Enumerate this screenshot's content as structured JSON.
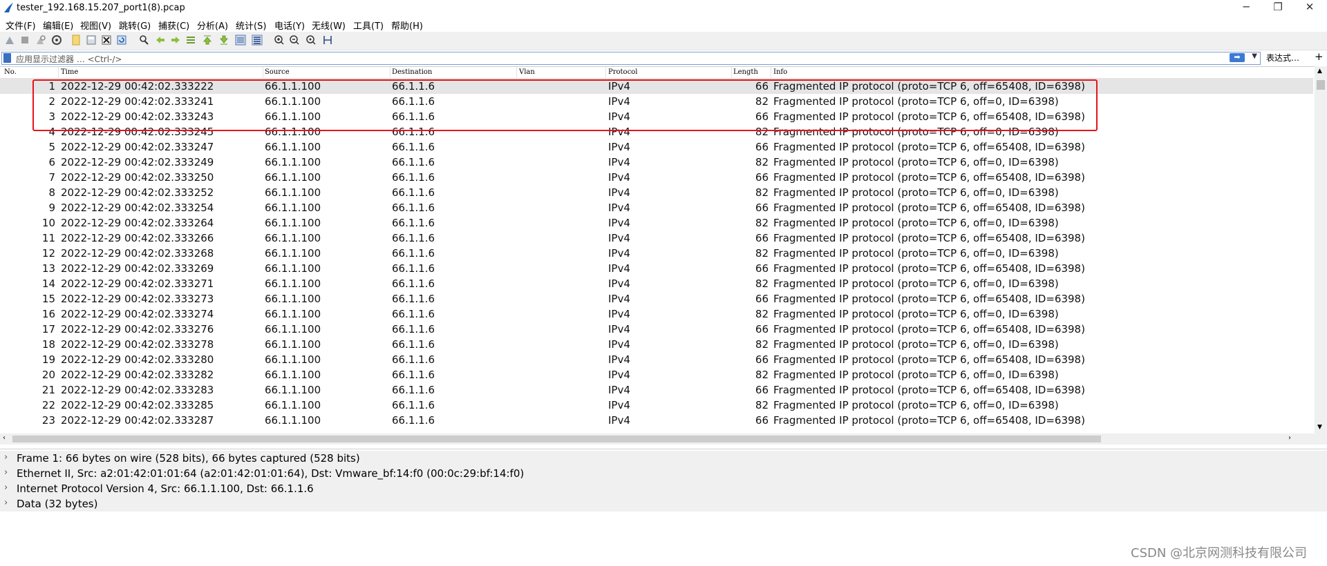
{
  "window": {
    "title": "tester_192.168.15.207_port1(8).pcap",
    "controls": {
      "minimize": "─",
      "restore": "❐",
      "close": "✕"
    }
  },
  "menu": [
    "文件(F)",
    "编辑(E)",
    "视图(V)",
    "跳转(G)",
    "捕获(C)",
    "分析(A)",
    "统计(S)",
    "电话(Y)",
    "无线(W)",
    "工具(T)",
    "帮助(H)"
  ],
  "toolbar_icons": [
    "start-capture-icon",
    "stop-capture-icon",
    "restart-capture-icon",
    "capture-options-icon",
    "open-file-icon",
    "save-file-icon",
    "close-file-icon",
    "reload-icon",
    "find-packet-icon",
    "go-back-icon",
    "go-forward-icon",
    "go-to-packet-icon",
    "go-first-icon",
    "go-last-icon",
    "autoscroll-icon",
    "colorize-icon",
    "zoom-in-icon",
    "zoom-out-icon",
    "zoom-normal-icon",
    "resize-columns-icon"
  ],
  "filter": {
    "placeholder": "应用显示过滤器 … <Ctrl-/>",
    "apply_label": "➡",
    "expression_label": "表达式…",
    "add_label": "+"
  },
  "columns": {
    "no": "No.",
    "time": "Time",
    "source": "Source",
    "destination": "Destination",
    "vlan": "Vlan",
    "protocol": "Protocol",
    "length": "Length",
    "info": "Info"
  },
  "packets": [
    {
      "no": "1",
      "time": "2022-12-29 00:42:02.333222",
      "src": "66.1.1.100",
      "dst": "66.1.1.6",
      "vlan": "",
      "proto": "IPv4",
      "len": "66",
      "info": "Fragmented IP protocol (proto=TCP 6, off=65408, ID=6398)"
    },
    {
      "no": "2",
      "time": "2022-12-29 00:42:02.333241",
      "src": "66.1.1.100",
      "dst": "66.1.1.6",
      "vlan": "",
      "proto": "IPv4",
      "len": "82",
      "info": "Fragmented IP protocol (proto=TCP 6, off=0, ID=6398)"
    },
    {
      "no": "3",
      "time": "2022-12-29 00:42:02.333243",
      "src": "66.1.1.100",
      "dst": "66.1.1.6",
      "vlan": "",
      "proto": "IPv4",
      "len": "66",
      "info": "Fragmented IP protocol (proto=TCP 6, off=65408, ID=6398)"
    },
    {
      "no": "4",
      "time": "2022-12-29 00:42:02.333245",
      "src": "66.1.1.100",
      "dst": "66.1.1.6",
      "vlan": "",
      "proto": "IPv4",
      "len": "82",
      "info": "Fragmented IP protocol (proto=TCP 6, off=0, ID=6398)"
    },
    {
      "no": "5",
      "time": "2022-12-29 00:42:02.333247",
      "src": "66.1.1.100",
      "dst": "66.1.1.6",
      "vlan": "",
      "proto": "IPv4",
      "len": "66",
      "info": "Fragmented IP protocol (proto=TCP 6, off=65408, ID=6398)"
    },
    {
      "no": "6",
      "time": "2022-12-29 00:42:02.333249",
      "src": "66.1.1.100",
      "dst": "66.1.1.6",
      "vlan": "",
      "proto": "IPv4",
      "len": "82",
      "info": "Fragmented IP protocol (proto=TCP 6, off=0, ID=6398)"
    },
    {
      "no": "7",
      "time": "2022-12-29 00:42:02.333250",
      "src": "66.1.1.100",
      "dst": "66.1.1.6",
      "vlan": "",
      "proto": "IPv4",
      "len": "66",
      "info": "Fragmented IP protocol (proto=TCP 6, off=65408, ID=6398)"
    },
    {
      "no": "8",
      "time": "2022-12-29 00:42:02.333252",
      "src": "66.1.1.100",
      "dst": "66.1.1.6",
      "vlan": "",
      "proto": "IPv4",
      "len": "82",
      "info": "Fragmented IP protocol (proto=TCP 6, off=0, ID=6398)"
    },
    {
      "no": "9",
      "time": "2022-12-29 00:42:02.333254",
      "src": "66.1.1.100",
      "dst": "66.1.1.6",
      "vlan": "",
      "proto": "IPv4",
      "len": "66",
      "info": "Fragmented IP protocol (proto=TCP 6, off=65408, ID=6398)"
    },
    {
      "no": "10",
      "time": "2022-12-29 00:42:02.333264",
      "src": "66.1.1.100",
      "dst": "66.1.1.6",
      "vlan": "",
      "proto": "IPv4",
      "len": "82",
      "info": "Fragmented IP protocol (proto=TCP 6, off=0, ID=6398)"
    },
    {
      "no": "11",
      "time": "2022-12-29 00:42:02.333266",
      "src": "66.1.1.100",
      "dst": "66.1.1.6",
      "vlan": "",
      "proto": "IPv4",
      "len": "66",
      "info": "Fragmented IP protocol (proto=TCP 6, off=65408, ID=6398)"
    },
    {
      "no": "12",
      "time": "2022-12-29 00:42:02.333268",
      "src": "66.1.1.100",
      "dst": "66.1.1.6",
      "vlan": "",
      "proto": "IPv4",
      "len": "82",
      "info": "Fragmented IP protocol (proto=TCP 6, off=0, ID=6398)"
    },
    {
      "no": "13",
      "time": "2022-12-29 00:42:02.333269",
      "src": "66.1.1.100",
      "dst": "66.1.1.6",
      "vlan": "",
      "proto": "IPv4",
      "len": "66",
      "info": "Fragmented IP protocol (proto=TCP 6, off=65408, ID=6398)"
    },
    {
      "no": "14",
      "time": "2022-12-29 00:42:02.333271",
      "src": "66.1.1.100",
      "dst": "66.1.1.6",
      "vlan": "",
      "proto": "IPv4",
      "len": "82",
      "info": "Fragmented IP protocol (proto=TCP 6, off=0, ID=6398)"
    },
    {
      "no": "15",
      "time": "2022-12-29 00:42:02.333273",
      "src": "66.1.1.100",
      "dst": "66.1.1.6",
      "vlan": "",
      "proto": "IPv4",
      "len": "66",
      "info": "Fragmented IP protocol (proto=TCP 6, off=65408, ID=6398)"
    },
    {
      "no": "16",
      "time": "2022-12-29 00:42:02.333274",
      "src": "66.1.1.100",
      "dst": "66.1.1.6",
      "vlan": "",
      "proto": "IPv4",
      "len": "82",
      "info": "Fragmented IP protocol (proto=TCP 6, off=0, ID=6398)"
    },
    {
      "no": "17",
      "time": "2022-12-29 00:42:02.333276",
      "src": "66.1.1.100",
      "dst": "66.1.1.6",
      "vlan": "",
      "proto": "IPv4",
      "len": "66",
      "info": "Fragmented IP protocol (proto=TCP 6, off=65408, ID=6398)"
    },
    {
      "no": "18",
      "time": "2022-12-29 00:42:02.333278",
      "src": "66.1.1.100",
      "dst": "66.1.1.6",
      "vlan": "",
      "proto": "IPv4",
      "len": "82",
      "info": "Fragmented IP protocol (proto=TCP 6, off=0, ID=6398)"
    },
    {
      "no": "19",
      "time": "2022-12-29 00:42:02.333280",
      "src": "66.1.1.100",
      "dst": "66.1.1.6",
      "vlan": "",
      "proto": "IPv4",
      "len": "66",
      "info": "Fragmented IP protocol (proto=TCP 6, off=65408, ID=6398)"
    },
    {
      "no": "20",
      "time": "2022-12-29 00:42:02.333282",
      "src": "66.1.1.100",
      "dst": "66.1.1.6",
      "vlan": "",
      "proto": "IPv4",
      "len": "82",
      "info": "Fragmented IP protocol (proto=TCP 6, off=0, ID=6398)"
    },
    {
      "no": "21",
      "time": "2022-12-29 00:42:02.333283",
      "src": "66.1.1.100",
      "dst": "66.1.1.6",
      "vlan": "",
      "proto": "IPv4",
      "len": "66",
      "info": "Fragmented IP protocol (proto=TCP 6, off=65408, ID=6398)"
    },
    {
      "no": "22",
      "time": "2022-12-29 00:42:02.333285",
      "src": "66.1.1.100",
      "dst": "66.1.1.6",
      "vlan": "",
      "proto": "IPv4",
      "len": "82",
      "info": "Fragmented IP protocol (proto=TCP 6, off=0, ID=6398)"
    },
    {
      "no": "23",
      "time": "2022-12-29 00:42:02.333287",
      "src": "66.1.1.100",
      "dst": "66.1.1.6",
      "vlan": "",
      "proto": "IPv4",
      "len": "66",
      "info": "Fragmented IP protocol (proto=TCP 6, off=65408, ID=6398)"
    }
  ],
  "selected_packet": "1",
  "highlight_color": "#e8121b",
  "details": [
    "Frame 1: 66 bytes on wire (528 bits), 66 bytes captured (528 bits)",
    "Ethernet II, Src: a2:01:42:01:01:64 (a2:01:42:01:01:64), Dst: Vmware_bf:14:f0 (00:0c:29:bf:14:f0)",
    "Internet Protocol Version 4, Src: 66.1.1.100, Dst: 66.1.1.6",
    "Data (32 bytes)"
  ],
  "watermark": "CSDN @北京网测科技有限公司"
}
